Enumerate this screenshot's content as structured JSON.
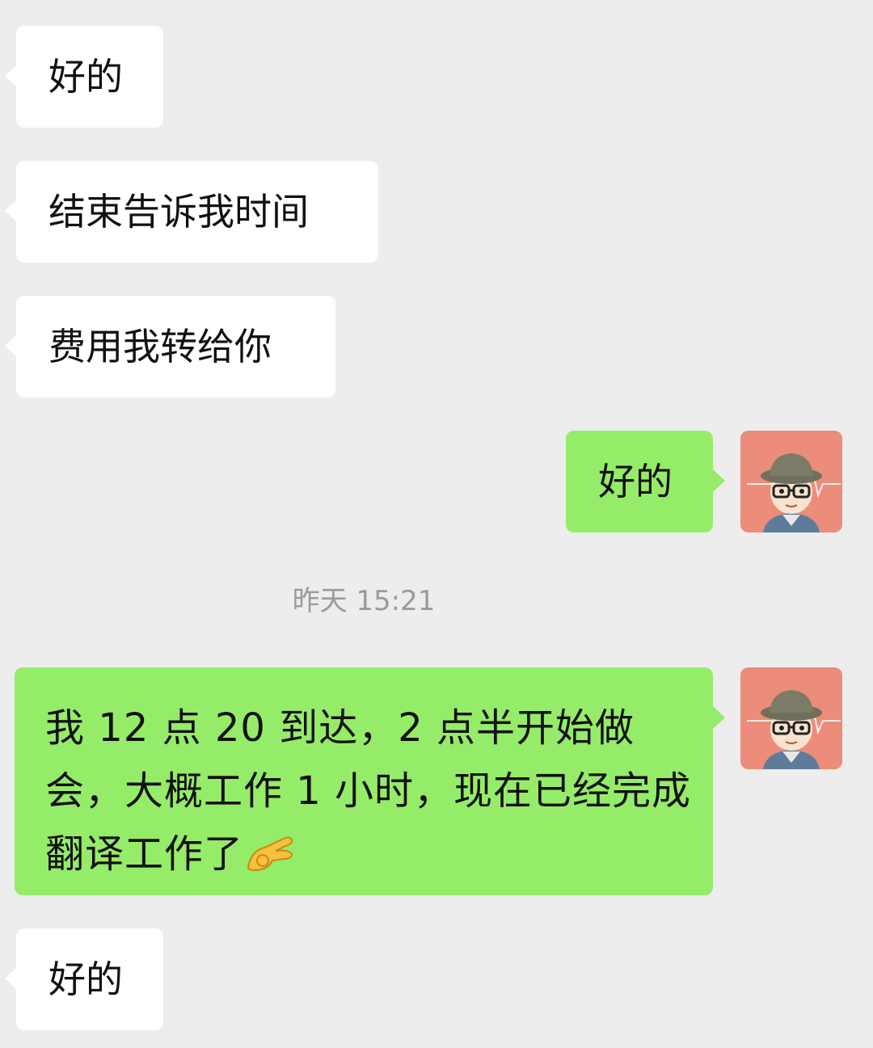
{
  "messages": [
    {
      "side": "in",
      "text": "好的"
    },
    {
      "side": "in",
      "text": "结束告诉我时间"
    },
    {
      "side": "in",
      "text": "费用我转给你"
    },
    {
      "side": "out",
      "text": "好的"
    },
    {
      "side": "out",
      "text": "我 12 点 20 到达，2 点半开始做会，大概工作 1 小时，现在已经完成翻译工作了",
      "trailing_icon": "ok-hand-emoji"
    },
    {
      "side": "in",
      "text": "好的"
    }
  ],
  "timestamp": "昨天 15:21",
  "avatar": {
    "icon": "user-avatar-icon",
    "bg_color": "#ec8c7a"
  },
  "colors": {
    "background": "#ededed",
    "incoming_bubble": "#ffffff",
    "outgoing_bubble": "#95ec69",
    "timestamp_text": "#9a9a9a"
  }
}
